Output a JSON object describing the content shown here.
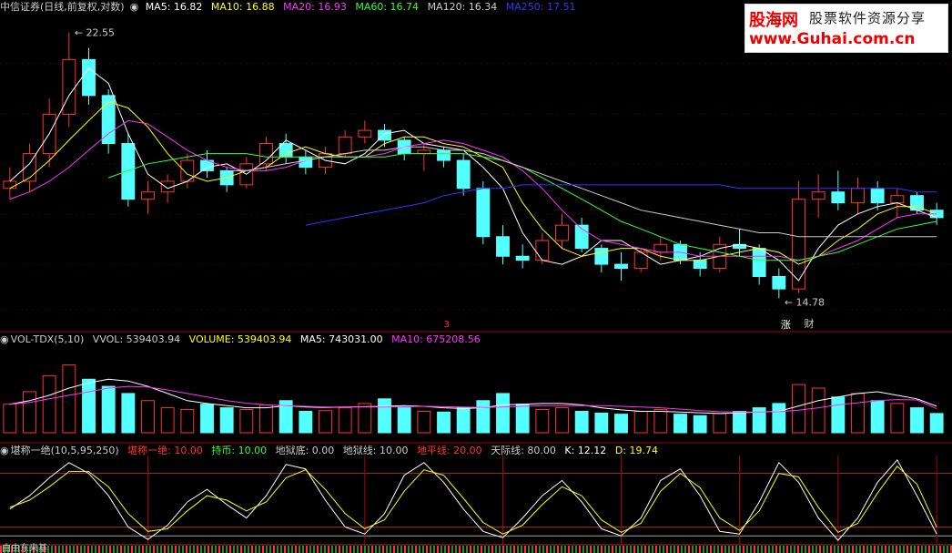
{
  "main_header": {
    "title": "中信证券(日线,前复权,对数)",
    "items": [
      {
        "label": "MA5: 16.82",
        "color": "#ffffff"
      },
      {
        "label": "MA10: 16.88",
        "color": "#ffff00"
      },
      {
        "label": "MA20: 16.93",
        "color": "#ff33ff"
      },
      {
        "label": "MA60: 16.74",
        "color": "#33ff33"
      },
      {
        "label": "MA120: 16.34",
        "color": "#cccccc"
      },
      {
        "label": "MA250: 17.51",
        "color": "#3333ff"
      }
    ]
  },
  "vol_header": {
    "title": "VOL-TDX(5,10)",
    "items": [
      {
        "label": "VVOL: 539403.94",
        "color": "#cccccc"
      },
      {
        "label": "VOLUME: 539403.94",
        "color": "#ffff00"
      },
      {
        "label": "MA5: 743031.00",
        "color": "#ffffff"
      },
      {
        "label": "MA10: 675208.56",
        "color": "#ff33ff"
      }
    ]
  },
  "ind_header": {
    "title": "堪称一绝(10,5,95,250)",
    "items": [
      {
        "label": "堪称一绝: 10.00",
        "color": "#ff3333"
      },
      {
        "label": "持币: 10.00",
        "color": "#33ff33"
      },
      {
        "label": "地狱底: 0.00",
        "color": "#cccccc"
      },
      {
        "label": "地狱线: 10.00",
        "color": "#cccccc"
      },
      {
        "label": "地平线: 20.00",
        "color": "#ff3333"
      },
      {
        "label": "天际线: 80.00",
        "color": "#cccccc"
      },
      {
        "label": "K: 12.12",
        "color": "#ffffff"
      },
      {
        "label": "D: 19.74",
        "color": "#ffff00"
      }
    ]
  },
  "watermark": {
    "logo": "股海网",
    "slogan": "股票软件资源分享",
    "url": "www.Guhai.com.cn"
  },
  "annotations": {
    "high_label": "22.55",
    "low_label": "14.78",
    "marker_1": "3",
    "marker_2": "涨",
    "marker_3": "财",
    "bottom_text": "由由东来基"
  },
  "colors": {
    "up": "#ff3232",
    "down": "#54ffff",
    "ma5": "#ffffff",
    "ma10": "#ffff00",
    "ma20": "#ff33ff",
    "ma60": "#33ff33",
    "ma120": "#cccccc",
    "ma250": "#3333ff",
    "divider": "#aa0000",
    "k_line": "#ffffff",
    "d_line": "#ffff00"
  },
  "chart_data": [
    {
      "type": "candlestick",
      "title": "中信证券(日线,前复权,对数)",
      "scale": "log",
      "ylim": [
        14.2,
        23.2
      ],
      "series": [
        {
          "name": "MA5",
          "values": [
            17.8,
            18.3,
            19.2,
            20.4,
            21.3,
            20.8,
            19.2,
            18.0,
            17.6,
            17.8,
            18.2,
            18.3,
            18.0,
            18.4,
            19.0,
            18.7,
            18.4,
            18.3,
            18.6,
            19.2,
            19.3,
            18.9,
            18.8,
            18.7,
            18.2,
            17.6,
            16.4,
            15.7,
            15.6,
            15.8,
            16.2,
            16.2,
            15.9,
            15.6,
            15.7,
            15.8,
            16.0,
            16.1,
            16.0,
            15.7,
            15.2,
            16.0,
            16.6,
            16.9,
            17.1,
            17.2,
            17.0,
            16.8
          ]
        },
        {
          "name": "MA10",
          "values": [
            17.6,
            17.9,
            18.4,
            19.0,
            19.6,
            20.2,
            20.0,
            19.4,
            18.6,
            18.0,
            17.8,
            17.9,
            18.1,
            18.2,
            18.6,
            18.8,
            18.6,
            18.5,
            18.5,
            18.9,
            19.1,
            19.1,
            18.9,
            18.8,
            18.5,
            18.2,
            17.2,
            16.5,
            16.0,
            15.8,
            15.9,
            16.0,
            16.0,
            15.8,
            15.7,
            15.7,
            15.8,
            15.9,
            16.0,
            15.9,
            15.6,
            15.8,
            16.2,
            16.5,
            16.9,
            17.1,
            17.1,
            16.9
          ]
        },
        {
          "name": "MA20",
          "values": [
            17.3,
            17.5,
            17.8,
            18.2,
            18.7,
            19.2,
            19.6,
            19.5,
            19.1,
            18.7,
            18.4,
            18.2,
            18.1,
            18.1,
            18.2,
            18.4,
            18.5,
            18.5,
            18.5,
            18.6,
            18.8,
            18.9,
            19.0,
            18.9,
            18.7,
            18.5,
            18.1,
            17.6,
            17.0,
            16.5,
            16.2,
            16.1,
            16.0,
            15.9,
            15.9,
            15.8,
            15.8,
            15.8,
            15.8,
            15.8,
            15.7,
            15.8,
            16.0,
            16.2,
            16.5,
            16.8,
            16.9,
            16.9
          ]
        },
        {
          "name": "MA60",
          "values": [
            null,
            null,
            null,
            null,
            null,
            17.9,
            18.1,
            18.3,
            18.4,
            18.5,
            18.6,
            18.6,
            18.6,
            18.5,
            18.5,
            18.5,
            18.5,
            18.5,
            18.5,
            18.5,
            18.6,
            18.6,
            18.6,
            18.6,
            18.5,
            18.4,
            18.2,
            17.9,
            17.6,
            17.3,
            17.0,
            16.7,
            16.5,
            16.3,
            16.1,
            16.0,
            15.9,
            15.8,
            15.7,
            15.7,
            15.7,
            15.8,
            15.9,
            16.1,
            16.3,
            16.5,
            16.6,
            16.7
          ]
        },
        {
          "name": "MA120",
          "values": [
            null,
            null,
            null,
            null,
            null,
            null,
            null,
            null,
            null,
            null,
            null,
            18.1,
            18.1,
            18.2,
            18.3,
            18.4,
            18.5,
            18.6,
            18.7,
            18.7,
            18.8,
            18.8,
            18.7,
            18.7,
            18.6,
            18.4,
            18.2,
            18.0,
            17.8,
            17.6,
            17.4,
            17.2,
            17.0,
            16.9,
            16.8,
            16.7,
            16.6,
            16.5,
            16.4,
            16.4,
            16.3,
            16.3,
            16.3,
            16.3,
            16.3,
            16.3,
            16.3,
            16.3
          ]
        },
        {
          "name": "MA250",
          "values": [
            null,
            null,
            null,
            null,
            null,
            null,
            null,
            null,
            null,
            null,
            null,
            null,
            null,
            null,
            null,
            16.6,
            16.7,
            16.8,
            16.9,
            17.0,
            17.1,
            17.2,
            17.4,
            17.5,
            17.6,
            17.6,
            17.7,
            17.7,
            17.7,
            17.7,
            17.7,
            17.7,
            17.7,
            17.7,
            17.7,
            17.7,
            17.7,
            17.6,
            17.6,
            17.6,
            17.6,
            17.6,
            17.6,
            17.6,
            17.6,
            17.6,
            17.5,
            17.5
          ]
        }
      ],
      "candles": [
        [
          17.6,
          18.2,
          17.3,
          17.8
        ],
        [
          17.8,
          18.9,
          17.5,
          18.6
        ],
        [
          18.6,
          20.3,
          18.2,
          19.8
        ],
        [
          19.8,
          22.55,
          19.4,
          21.6
        ],
        [
          21.6,
          22.0,
          20.1,
          20.4
        ],
        [
          20.4,
          20.6,
          18.6,
          18.9
        ],
        [
          18.9,
          19.2,
          17.1,
          17.3
        ],
        [
          17.3,
          17.8,
          16.9,
          17.5
        ],
        [
          17.5,
          18.0,
          17.2,
          17.8
        ],
        [
          17.8,
          18.6,
          17.6,
          18.4
        ],
        [
          18.4,
          18.7,
          17.9,
          18.1
        ],
        [
          18.1,
          18.2,
          17.5,
          17.7
        ],
        [
          17.7,
          18.5,
          17.6,
          18.3
        ],
        [
          18.3,
          19.1,
          18.1,
          18.9
        ],
        [
          18.9,
          19.2,
          18.3,
          18.5
        ],
        [
          18.5,
          18.7,
          18.0,
          18.2
        ],
        [
          18.2,
          18.8,
          18.0,
          18.6
        ],
        [
          18.6,
          19.3,
          18.5,
          19.1
        ],
        [
          19.1,
          19.6,
          18.9,
          19.3
        ],
        [
          19.3,
          19.5,
          18.8,
          19.0
        ],
        [
          19.0,
          19.1,
          18.4,
          18.6
        ],
        [
          18.6,
          18.9,
          18.1,
          18.7
        ],
        [
          18.7,
          18.8,
          18.2,
          18.4
        ],
        [
          18.4,
          18.6,
          17.4,
          17.6
        ],
        [
          17.6,
          17.8,
          16.1,
          16.3
        ],
        [
          16.3,
          16.6,
          15.6,
          15.8
        ],
        [
          15.8,
          16.1,
          15.5,
          15.7
        ],
        [
          15.7,
          16.4,
          15.6,
          16.2
        ],
        [
          16.2,
          16.9,
          16.0,
          16.6
        ],
        [
          16.6,
          16.8,
          15.9,
          16.0
        ],
        [
          16.0,
          16.1,
          15.4,
          15.6
        ],
        [
          15.6,
          15.9,
          15.2,
          15.5
        ],
        [
          15.5,
          16.0,
          15.4,
          15.9
        ],
        [
          15.9,
          16.3,
          15.7,
          16.1
        ],
        [
          16.1,
          16.2,
          15.6,
          15.7
        ],
        [
          15.7,
          15.9,
          15.3,
          15.5
        ],
        [
          15.5,
          16.3,
          15.4,
          16.1
        ],
        [
          16.1,
          16.5,
          15.8,
          16.0
        ],
        [
          16.0,
          16.1,
          15.1,
          15.3
        ],
        [
          15.3,
          15.5,
          14.78,
          15.0
        ],
        [
          15.0,
          17.8,
          14.9,
          17.3
        ],
        [
          17.3,
          18.0,
          16.8,
          17.5
        ],
        [
          17.5,
          18.1,
          17.0,
          17.2
        ],
        [
          17.2,
          17.9,
          16.9,
          17.6
        ],
        [
          17.6,
          17.8,
          17.0,
          17.2
        ],
        [
          17.2,
          17.6,
          16.8,
          17.4
        ],
        [
          17.4,
          17.5,
          16.9,
          17.0
        ],
        [
          17.0,
          17.2,
          16.6,
          16.8
        ]
      ]
    },
    {
      "type": "bar",
      "title": "VOL-TDX(5,10)",
      "ylim": [
        0,
        2400000
      ],
      "series": [
        {
          "name": "VOLUME",
          "values": [
            800000,
            1150000,
            1600000,
            1900000,
            1500000,
            1300000,
            1100000,
            900000,
            700000,
            650000,
            800000,
            700000,
            650000,
            780000,
            900000,
            600000,
            620000,
            700000,
            820000,
            950000,
            700000,
            600000,
            580000,
            700000,
            900000,
            1100000,
            800000,
            650000,
            700000,
            600000,
            550000,
            520000,
            600000,
            650000,
            520000,
            480000,
            540000,
            600000,
            700000,
            820000,
            1350000,
            1250000,
            1000000,
            1100000,
            900000,
            820000,
            700000,
            539403.94
          ]
        },
        {
          "name": "MA5",
          "values": [
            800000,
            900000,
            1050000,
            1250000,
            1400000,
            1500000,
            1450000,
            1300000,
            1100000,
            900000,
            820000,
            760000,
            700000,
            700000,
            760000,
            720000,
            710000,
            720000,
            730000,
            740000,
            760000,
            740000,
            700000,
            680000,
            700000,
            780000,
            800000,
            820000,
            820000,
            780000,
            700000,
            640000,
            600000,
            600000,
            580000,
            560000,
            540000,
            560000,
            580000,
            600000,
            750000,
            900000,
            1000000,
            1100000,
            1150000,
            1050000,
            950000,
            743031
          ]
        },
        {
          "name": "MA10",
          "values": [
            800000,
            850000,
            950000,
            1050000,
            1150000,
            1250000,
            1300000,
            1280000,
            1200000,
            1100000,
            1000000,
            900000,
            830000,
            780000,
            760000,
            740000,
            720000,
            720000,
            720000,
            720000,
            730000,
            740000,
            730000,
            720000,
            710000,
            720000,
            740000,
            760000,
            760000,
            760000,
            760000,
            740000,
            720000,
            700000,
            660000,
            620000,
            590000,
            580000,
            580000,
            590000,
            630000,
            700000,
            780000,
            840000,
            900000,
            930000,
            920000,
            675208.56
          ]
        }
      ]
    },
    {
      "type": "line",
      "title": "堪称一绝(10,5,95,250)",
      "ylim": [
        0,
        100
      ],
      "reference_lines": {
        "天际线": 80,
        "地平线": 20,
        "地狱线": 10,
        "地狱底": 0
      },
      "series": [
        {
          "name": "K",
          "values": [
            40,
            55,
            75,
            92,
            80,
            55,
            20,
            6,
            22,
            48,
            62,
            45,
            30,
            55,
            90,
            85,
            50,
            20,
            12,
            35,
            78,
            92,
            70,
            40,
            15,
            8,
            30,
            55,
            72,
            48,
            18,
            10,
            30,
            72,
            85,
            55,
            15,
            12,
            48,
            92,
            70,
            30,
            5,
            30,
            70,
            95,
            55,
            12.12
          ]
        },
        {
          "name": "D",
          "values": [
            42,
            50,
            65,
            82,
            82,
            65,
            35,
            15,
            18,
            38,
            55,
            50,
            38,
            48,
            75,
            84,
            62,
            35,
            18,
            28,
            60,
            84,
            78,
            52,
            25,
            12,
            22,
            45,
            65,
            55,
            28,
            14,
            24,
            60,
            80,
            64,
            30,
            16,
            38,
            80,
            76,
            42,
            14,
            24,
            58,
            88,
            68,
            19.74
          ]
        }
      ]
    }
  ]
}
